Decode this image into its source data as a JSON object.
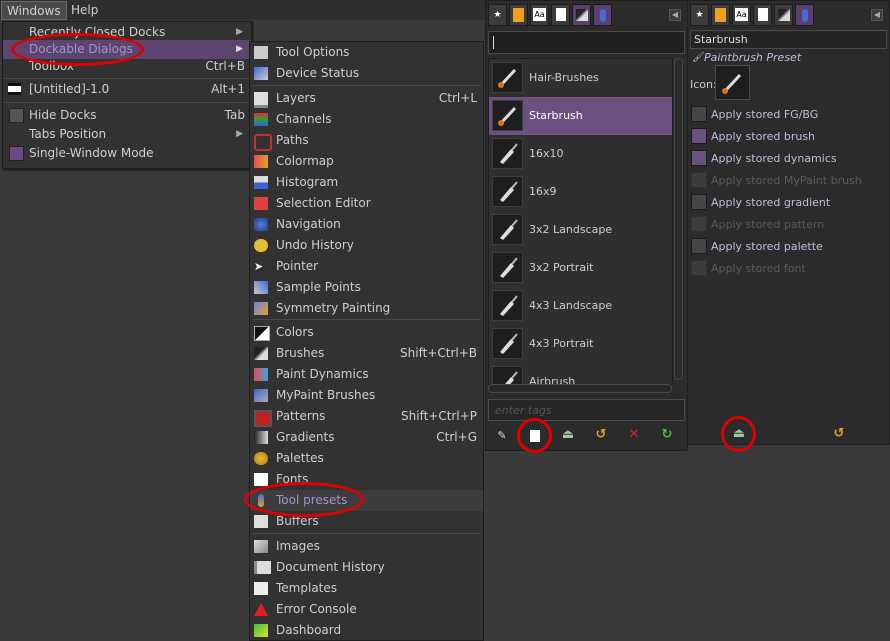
{
  "menubar": {
    "windows": "Windows",
    "help": "Help"
  },
  "windows_menu": {
    "recently_closed": "Recently Closed Docks",
    "dockable_dialogs": "Dockable Dialogs",
    "toolbox": "Toolbox",
    "toolbox_shortcut": "Ctrl+B",
    "untitled": "[Untitled]-1.0",
    "untitled_shortcut": "Alt+1",
    "hide_docks": "Hide Docks",
    "hide_docks_shortcut": "Tab",
    "tabs_position": "Tabs Position",
    "single_window": "Single-Window Mode"
  },
  "submenu": {
    "items": [
      {
        "label": "Tool Options",
        "shortcut": "",
        "icon": "tool-options-icon"
      },
      {
        "label": "Device Status",
        "shortcut": "",
        "icon": "device-status-icon"
      },
      {
        "label": "Layers",
        "shortcut": "Ctrl+L",
        "icon": "layers-icon"
      },
      {
        "label": "Channels",
        "shortcut": "",
        "icon": "channels-icon"
      },
      {
        "label": "Paths",
        "shortcut": "",
        "icon": "paths-icon"
      },
      {
        "label": "Colormap",
        "shortcut": "",
        "icon": "colormap-icon"
      },
      {
        "label": "Histogram",
        "shortcut": "",
        "icon": "histogram-icon"
      },
      {
        "label": "Selection Editor",
        "shortcut": "",
        "icon": "selection-editor-icon"
      },
      {
        "label": "Navigation",
        "shortcut": "",
        "icon": "navigation-icon"
      },
      {
        "label": "Undo History",
        "shortcut": "",
        "icon": "undo-history-icon"
      },
      {
        "label": "Pointer",
        "shortcut": "",
        "icon": "pointer-icon"
      },
      {
        "label": "Sample Points",
        "shortcut": "",
        "icon": "sample-points-icon"
      },
      {
        "label": "Symmetry Painting",
        "shortcut": "",
        "icon": "symmetry-icon"
      },
      {
        "label": "Colors",
        "shortcut": "",
        "icon": "colors-icon"
      },
      {
        "label": "Brushes",
        "shortcut": "Shift+Ctrl+B",
        "icon": "brushes-icon"
      },
      {
        "label": "Paint Dynamics",
        "shortcut": "",
        "icon": "paint-dynamics-icon"
      },
      {
        "label": "MyPaint Brushes",
        "shortcut": "",
        "icon": "mypaint-brushes-icon"
      },
      {
        "label": "Patterns",
        "shortcut": "Shift+Ctrl+P",
        "icon": "patterns-icon"
      },
      {
        "label": "Gradients",
        "shortcut": "Ctrl+G",
        "icon": "gradients-icon"
      },
      {
        "label": "Palettes",
        "shortcut": "",
        "icon": "palettes-icon"
      },
      {
        "label": "Fonts",
        "shortcut": "",
        "icon": "fonts-icon"
      },
      {
        "label": "Tool presets",
        "shortcut": "",
        "icon": "tool-presets-icon"
      },
      {
        "label": "Buffers",
        "shortcut": "",
        "icon": "buffers-icon"
      },
      {
        "label": "Images",
        "shortcut": "",
        "icon": "images-icon"
      },
      {
        "label": "Document History",
        "shortcut": "",
        "icon": "document-history-icon"
      },
      {
        "label": "Templates",
        "shortcut": "",
        "icon": "templates-icon"
      },
      {
        "label": "Error Console",
        "shortcut": "",
        "icon": "error-console-icon"
      },
      {
        "label": "Dashboard",
        "shortcut": "",
        "icon": "dashboard-icon"
      }
    ]
  },
  "presets_panel": {
    "tag_placeholder": "enter tags",
    "items": [
      {
        "label": "Hair-Brushes"
      },
      {
        "label": "Starbrush"
      },
      {
        "label": "16x10"
      },
      {
        "label": "16x9"
      },
      {
        "label": "3x2 Landscape"
      },
      {
        "label": "3x2 Portrait"
      },
      {
        "label": "4x3 Landscape"
      },
      {
        "label": "4x3 Portrait"
      },
      {
        "label": "Airbrush"
      }
    ]
  },
  "editor_panel": {
    "name": "Starbrush",
    "kind": "Paintbrush Preset",
    "icon_label": "Icon:",
    "options": [
      {
        "label": "Apply stored FG/BG",
        "checked": false,
        "enabled": true
      },
      {
        "label": "Apply stored brush",
        "checked": true,
        "enabled": true
      },
      {
        "label": "Apply stored dynamics",
        "checked": true,
        "enabled": true
      },
      {
        "label": "Apply stored MyPaint brush",
        "checked": false,
        "enabled": false
      },
      {
        "label": "Apply stored gradient",
        "checked": false,
        "enabled": true
      },
      {
        "label": "Apply stored pattern",
        "checked": false,
        "enabled": false
      },
      {
        "label": "Apply stored palette",
        "checked": false,
        "enabled": true
      },
      {
        "label": "Apply stored font",
        "checked": false,
        "enabled": false
      }
    ]
  },
  "colors": {
    "accent": "#6c5080",
    "highlight_text": "#a592d0",
    "annotation": "#e00000"
  }
}
